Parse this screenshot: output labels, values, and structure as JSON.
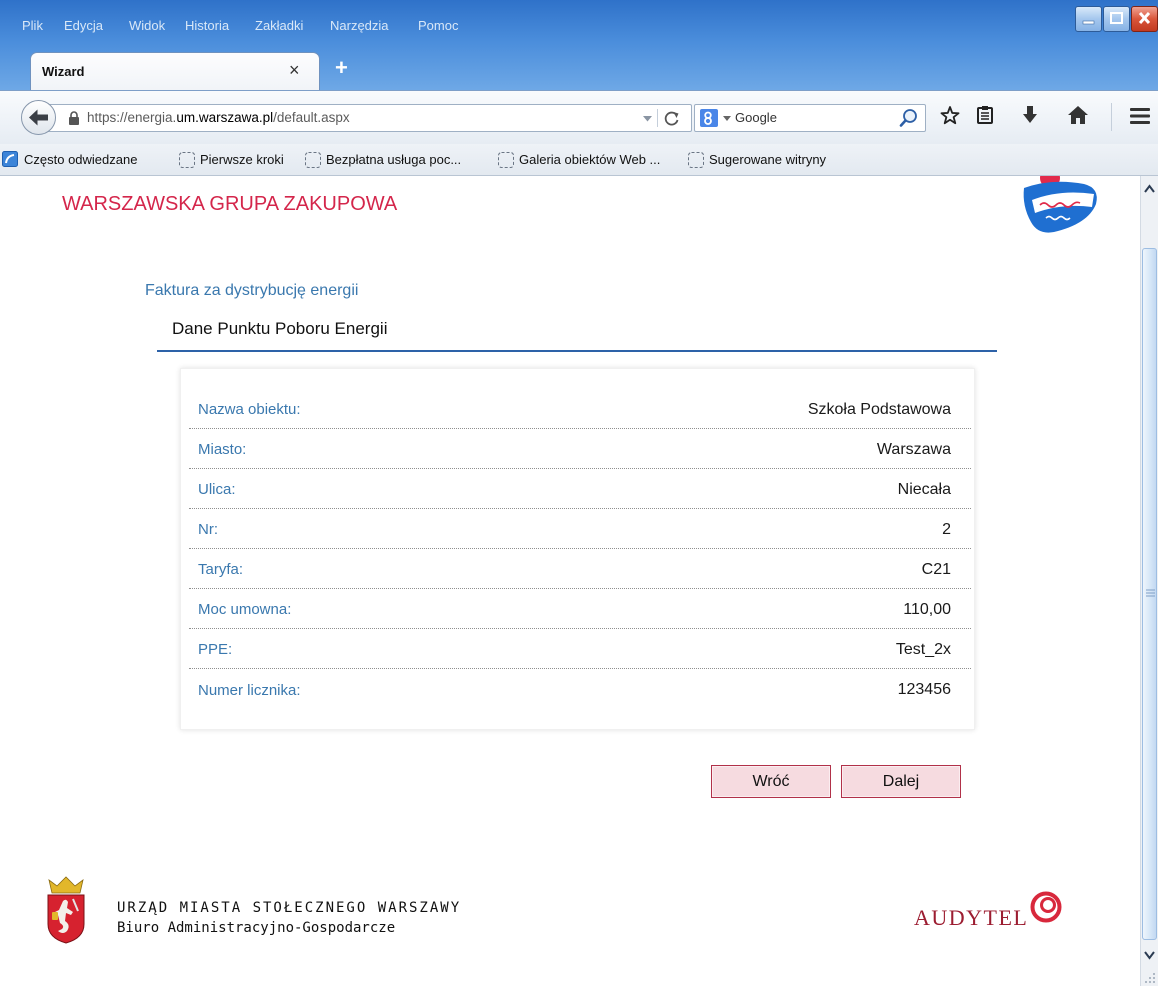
{
  "browser": {
    "menu": [
      "Plik",
      "Edycja",
      "Widok",
      "Historia",
      "Zakładki",
      "Narzędzia",
      "Pomoc"
    ],
    "tab": {
      "label": "Wizard",
      "close": "×"
    },
    "new_tab": "+",
    "address": {
      "prefix": "https://energia.",
      "domain": "um.warszawa.pl",
      "path": "/default.aspx"
    },
    "search": {
      "engine": "Google"
    },
    "bookmarks": [
      "Często odwiedzane",
      "Pierwsze kroki",
      "Bezpłatna usługa poc...",
      "Galeria obiektów Web ...",
      "Sugerowane witryny"
    ],
    "icons": [
      "minimize-icon",
      "maximize-icon",
      "close-icon",
      "back-arrow-icon",
      "lock-icon",
      "history-dropdown-icon",
      "reload-icon",
      "google-icon",
      "search-icon",
      "bookmark-star-icon",
      "reading-list-icon",
      "download-icon",
      "home-icon",
      "menu-icon",
      "most-visited-icon",
      "bookmark-placeholder-icon",
      "scroll-up-icon",
      "scroll-down-icon"
    ]
  },
  "page": {
    "site_title": "WARSZAWSKA GRUPA ZAKUPOWA",
    "section_title": "Faktura za dystrybucję energii",
    "subsection_title": "Dane Punktu Poboru Energii",
    "fields": [
      {
        "label": "Nazwa obiektu:",
        "value": "Szkoła Podstawowa"
      },
      {
        "label": "Miasto:",
        "value": "Warszawa"
      },
      {
        "label": "Ulica:",
        "value": "Niecała"
      },
      {
        "label": "Nr:",
        "value": "2"
      },
      {
        "label": "Taryfa:",
        "value": "C21"
      },
      {
        "label": "Moc umowna:",
        "value": "110,00"
      },
      {
        "label": "PPE:",
        "value": "Test_2x"
      },
      {
        "label": "Numer licznika:",
        "value": "123456"
      }
    ],
    "buttons": {
      "back": "Wróć",
      "next": "Dalej"
    },
    "footer": {
      "office": "URZĄD MIASTA STOŁECZNEGO WARSZAWY",
      "department": "Biuro Administracyjno-Gospodarcze",
      "partner": "AUDYTEL"
    }
  },
  "colors": {
    "titlebar": "#4a8ddb",
    "brand": "#d4264b",
    "label": "#3a78ae",
    "rule": "#2d62a8",
    "button_bg": "#f6dbe0",
    "button_border": "#b13149",
    "audytel": "#9c1d31"
  }
}
